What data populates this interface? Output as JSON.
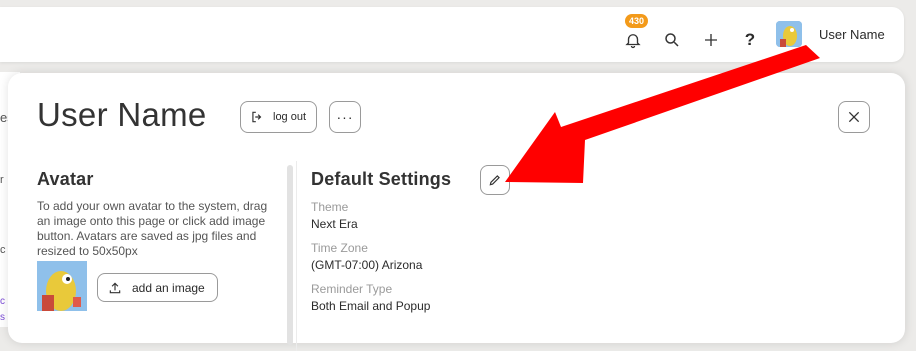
{
  "header": {
    "notification_count": "430",
    "user_name": "User Name",
    "icons": [
      "bell-icon",
      "search-icon",
      "plus-icon",
      "help-icon"
    ]
  },
  "background": {
    "fragments": [
      "es",
      "r",
      "c",
      "c",
      "s"
    ]
  },
  "panel": {
    "title": "User Name",
    "logout_label": "log out",
    "more_label": "···",
    "avatar": {
      "heading": "Avatar",
      "description": "To add your own avatar to the system, drag an image onto this page or click add image button. Avatars are saved as jpg files and resized to 50x50px",
      "add_image_label": "add an image"
    },
    "settings": {
      "heading": "Default Settings",
      "items": [
        {
          "label": "Theme",
          "value": "Next Era"
        },
        {
          "label": "Time Zone",
          "value": "(GMT-07:00) Arizona"
        },
        {
          "label": "Reminder Type",
          "value": "Both Email and Popup"
        }
      ]
    }
  },
  "colors": {
    "badge": "#f39a1a",
    "annotation_arrow": "#ff0000",
    "panel_bg": "#ffffff",
    "page_bg": "#ecebe9"
  }
}
